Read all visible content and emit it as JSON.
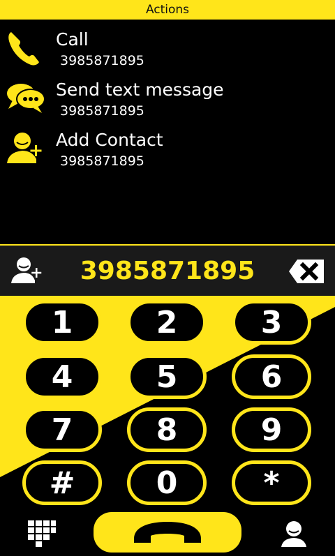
{
  "header": {
    "title": "Actions"
  },
  "actions": [
    {
      "icon": "phone-icon",
      "title": "Call",
      "number": "3985871895"
    },
    {
      "icon": "chat-bubbles-icon",
      "title": "Send text message",
      "number": "3985871895"
    },
    {
      "icon": "add-contact-icon",
      "title": "Add Contact",
      "number": "3985871895"
    }
  ],
  "dial": {
    "number": "3985871895",
    "keys": [
      "1",
      "2",
      "3",
      "4",
      "5",
      "6",
      "7",
      "8",
      "9",
      "#",
      "0",
      "*"
    ]
  },
  "colors": {
    "accent": "#FFE51A",
    "background": "#000000",
    "bar": "#1A1A1A"
  }
}
